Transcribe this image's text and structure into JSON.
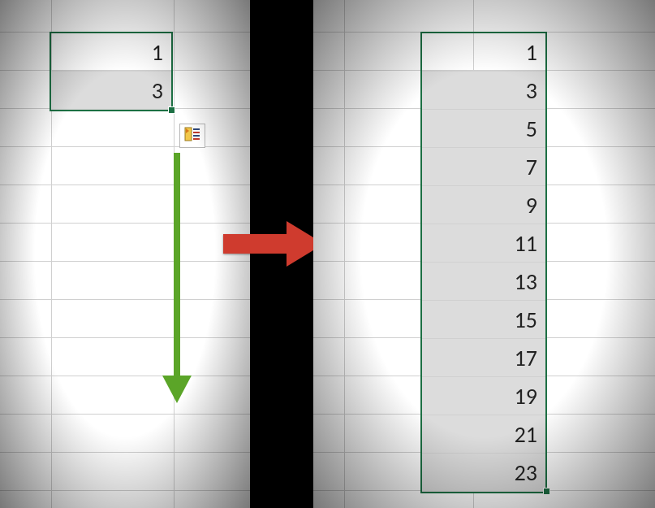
{
  "left_panel": {
    "selection": {
      "cells": [
        "1",
        "3"
      ],
      "shaded_index": 1
    }
  },
  "right_panel": {
    "selection": {
      "cells": [
        "1",
        "3",
        "5",
        "7",
        "9",
        "11",
        "13",
        "15",
        "17",
        "19",
        "21",
        "23"
      ],
      "shaded_from_index": 1
    }
  },
  "icons": {
    "autofill_options": "autofill-options-icon",
    "drag_down_arrow_color": "#5ba528",
    "transition_arrow_color": "#cf3b2e",
    "selection_border_color": "#1d7044"
  }
}
